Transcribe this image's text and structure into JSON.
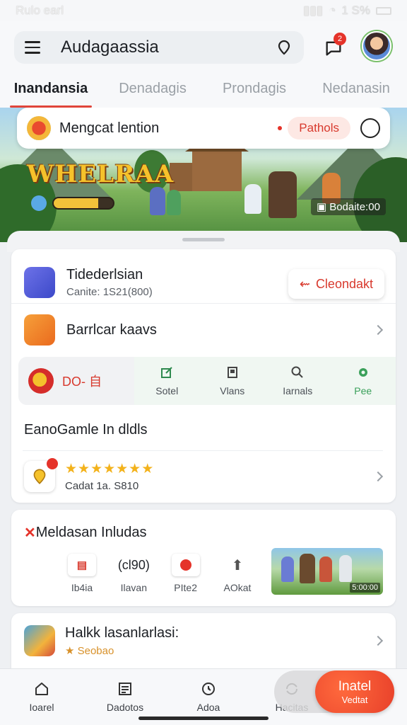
{
  "status_bar": {
    "time": "Rulo earl",
    "battery_text": "1 S%"
  },
  "header": {
    "app_title": "Audagaassia",
    "notification_count": "2"
  },
  "tabs": [
    {
      "label": "Inandansia"
    },
    {
      "label": "Denadagis"
    },
    {
      "label": "Prondagis"
    },
    {
      "label": "Nedanasin"
    }
  ],
  "banner": {
    "promo_title": "Mengcat lention",
    "promo_pill": "Pathols",
    "game_logo": "WHELRAA",
    "energy_level": 0.75,
    "score": "Bodaite:00"
  },
  "app_card": {
    "title": "Tidederlsian",
    "subtitle": "Canite: 1S21(800)",
    "download_label": "Cleondakt",
    "row2_title": "Barrlcar kaavs",
    "quick_action_label": "DO- 自",
    "actions": [
      {
        "label": "Sotel"
      },
      {
        "label": "Vlans"
      },
      {
        "label": "Iarnals"
      },
      {
        "label": "Pee"
      }
    ],
    "section_title": "EanoGamle In dldls",
    "rating_stars": "★★★★★★★",
    "rating_text": "Cadat 1a. S810"
  },
  "card_two": {
    "title": "Meldasan Inludas",
    "items": [
      {
        "label": "Ib4ia"
      },
      {
        "label": "Ilavan",
        "value": "(cl90)"
      },
      {
        "label": "PIte2"
      },
      {
        "label": "AOkat"
      }
    ],
    "thumb_label": "5:00:00"
  },
  "card_three": {
    "title": "Halkk lasanlarlasi:",
    "subtitle": "★ Seobao"
  },
  "bottom_nav": {
    "items": [
      {
        "label": "Ioarel"
      },
      {
        "label": "Dadotos"
      },
      {
        "label": "Adoa"
      },
      {
        "label": "Hacitas"
      }
    ],
    "fab_title": "Inatel",
    "fab_sub": "Vedtat"
  },
  "colors": {
    "accent": "#e0453a",
    "brand_green": "#3aa05a"
  }
}
